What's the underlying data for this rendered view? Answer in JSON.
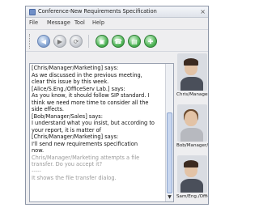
{
  "window": {
    "title": "Conference-New Requirements Specification",
    "close_glyph": "×"
  },
  "menu": [
    "File",
    "Message",
    "Tool",
    "Help"
  ],
  "toolbar": {
    "buttons": [
      {
        "icon": "back-icon",
        "glyph": "◀",
        "color": "#8aa8d4"
      },
      {
        "icon": "forward-icon",
        "glyph": "▶",
        "color": "#c9ccd2"
      },
      {
        "icon": "refresh-icon",
        "glyph": "⟳",
        "color": "#c9ccd2"
      },
      {
        "icon": "video-call-icon",
        "glyph": "▣",
        "color": "#52b65a"
      },
      {
        "icon": "voice-call-icon",
        "glyph": "☎",
        "color": "#52b65a"
      },
      {
        "icon": "conference-icon",
        "glyph": "▤",
        "color": "#52b65a"
      },
      {
        "icon": "add-participant-icon",
        "glyph": "✚",
        "color": "#52b65a"
      }
    ]
  },
  "chat": {
    "lines": [
      "[Chris/Manager/Marketing] says:",
      "As we discussed in the previous meeting,",
      "clear this issue by this week.",
      "[Alice/S.Eng./OfficeServ Lab.] says:",
      "As you know, it should follow SIP standard. I",
      "think we need more time to consider all the",
      "side effects.",
      "[Bob/Manager/Sales] says:",
      "I understand what you insist, but according to",
      "your report, it is matter of",
      "[Chris/Manager/Marketing] says:",
      "I'll send new requirements specification",
      "now."
    ],
    "system_lines": [
      "Chris/Manager/Marketing attempts a file",
      "transfer. Do you accept it?",
      "-----",
      "It shows the file transfer dialog."
    ]
  },
  "participants": [
    {
      "name": "Chris/Manager/...",
      "avatar": "male"
    },
    {
      "name": "Bob/Manager/S...",
      "avatar": "female"
    },
    {
      "name": "Sam/Eng./Offic...",
      "avatar": "male"
    }
  ],
  "colors": {
    "window_bg": "#eeeef0",
    "accent": "#8aa8d4",
    "call_green": "#52b65a"
  }
}
